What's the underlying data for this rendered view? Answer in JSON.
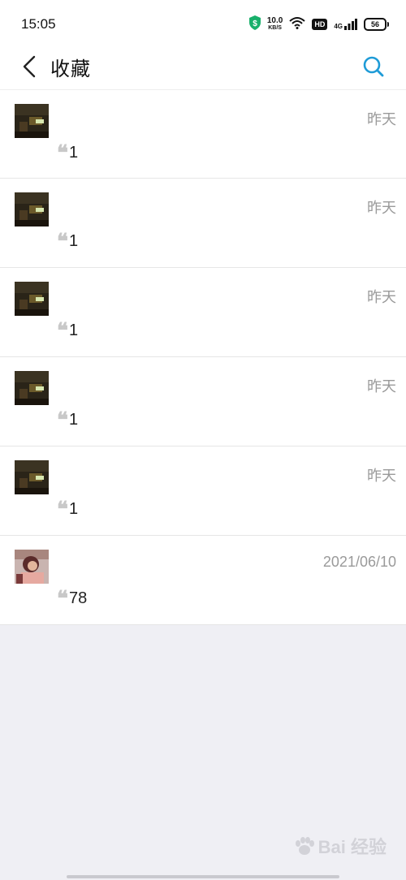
{
  "status_bar": {
    "time": "15:05",
    "net_speed": "10.0",
    "net_speed_unit": "KB/S",
    "hd_label": "HD",
    "signal_label": "4G",
    "battery": "56"
  },
  "header": {
    "title": "收藏"
  },
  "favorites": [
    {
      "date": "昨天",
      "quote": "1",
      "avatar": "dark-room-photo"
    },
    {
      "date": "昨天",
      "quote": "1",
      "avatar": "dark-room-photo"
    },
    {
      "date": "昨天",
      "quote": "1",
      "avatar": "dark-room-photo"
    },
    {
      "date": "昨天",
      "quote": "1",
      "avatar": "dark-room-photo"
    },
    {
      "date": "昨天",
      "quote": "1",
      "avatar": "dark-room-photo"
    },
    {
      "date": "2021/06/10",
      "quote": "78",
      "avatar": "portrait-photo"
    }
  ],
  "quote_mark": "❝",
  "watermark": {
    "text": "Bai 经验"
  },
  "colors": {
    "accent": "#1e9bd7",
    "background": "#efeff4",
    "date_text": "#9a9a9a"
  }
}
